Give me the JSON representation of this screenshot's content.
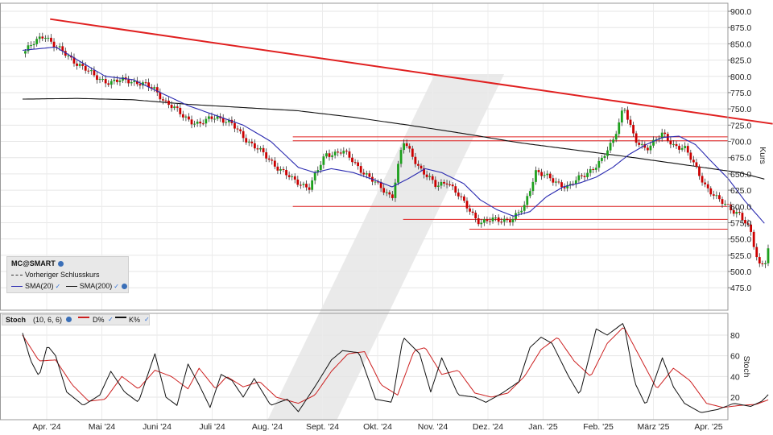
{
  "chart_data": [
    {
      "type": "candlestick",
      "symbol": "MC@SMART",
      "ylabel": "Kurs",
      "ylim": [
        460,
        915
      ],
      "y_ticks": [
        "900.0",
        "875.0",
        "850.0",
        "825.0",
        "800.0",
        "775.0",
        "750.0",
        "725.0",
        "700.0",
        "675.0",
        "650.0",
        "625.0",
        "600.0",
        "575.0",
        "550.0",
        "525.0",
        "500.0",
        "475.0"
      ],
      "x_ticks": [
        "Apr. '24",
        "Mai '24",
        "Juni '24",
        "Juli '24",
        "Aug. '24",
        "Sept. '24",
        "Okt. '24",
        "Nov. '24",
        "Dez. '24",
        "Jan. '25",
        "Feb. '25",
        "März '25",
        "Apr. '25"
      ],
      "legend": {
        "title": "MC@SMART",
        "prev_close_label": "Vorheriger Schlusskurs",
        "sma20_label": "SMA(20)",
        "sma200_label": "SMA(200)"
      },
      "colors": {
        "up": "#1ea01e",
        "down": "#cc0000",
        "sma20": "#2a2ab0",
        "sma200": "#111111",
        "trend": "#e02020"
      },
      "trendline": {
        "from": [
          0.5,
          888
        ],
        "to": [
          13.6,
          727
        ]
      },
      "horizontal_levels": [
        {
          "value": 707,
          "from": 4.9
        },
        {
          "value": 701,
          "from": 4.9
        },
        {
          "value": 600,
          "from": 4.9
        },
        {
          "value": 580,
          "from": 6.9
        },
        {
          "value": 565,
          "from": 8.1
        }
      ],
      "series": [
        {
          "name": "Kurs",
          "key_points": [
            [
              0.0,
              835
            ],
            [
              0.4,
              865
            ],
            [
              0.6,
              845
            ],
            [
              1.0,
              820
            ],
            [
              1.3,
              800
            ],
            [
              1.6,
              790
            ],
            [
              1.9,
              795
            ],
            [
              2.1,
              790
            ],
            [
              2.4,
              780
            ],
            [
              2.6,
              760
            ],
            [
              2.9,
              740
            ],
            [
              3.2,
              725
            ],
            [
              3.5,
              740
            ],
            [
              3.8,
              725
            ],
            [
              4.1,
              700
            ],
            [
              4.5,
              670
            ],
            [
              4.9,
              640
            ],
            [
              5.2,
              630
            ],
            [
              5.5,
              680
            ],
            [
              5.8,
              685
            ],
            [
              6.1,
              660
            ],
            [
              6.4,
              635
            ],
            [
              6.7,
              615
            ],
            [
              6.9,
              700
            ],
            [
              7.2,
              660
            ],
            [
              7.5,
              630
            ],
            [
              7.7,
              640
            ],
            [
              8.0,
              605
            ],
            [
              8.3,
              575
            ],
            [
              8.6,
              580
            ],
            [
              8.9,
              580
            ],
            [
              9.1,
              600
            ],
            [
              9.3,
              655
            ],
            [
              9.6,
              640
            ],
            [
              9.9,
              630
            ],
            [
              10.2,
              650
            ],
            [
              10.5,
              670
            ],
            [
              10.7,
              700
            ],
            [
              10.9,
              755
            ],
            [
              11.1,
              700
            ],
            [
              11.3,
              690
            ],
            [
              11.6,
              710
            ],
            [
              11.8,
              695
            ],
            [
              12.0,
              690
            ],
            [
              12.2,
              660
            ],
            [
              12.4,
              630
            ],
            [
              12.6,
              610
            ],
            [
              12.8,
              600
            ],
            [
              13.0,
              588
            ],
            [
              13.2,
              560
            ],
            [
              13.35,
              510
            ],
            [
              13.5,
              520
            ],
            [
              13.55,
              560
            ]
          ]
        },
        {
          "name": "SMA(20)",
          "key_points": [
            [
              0.0,
              840
            ],
            [
              0.6,
              845
            ],
            [
              1.0,
              825
            ],
            [
              1.5,
              800
            ],
            [
              2.0,
              795
            ],
            [
              2.5,
              775
            ],
            [
              3.0,
              755
            ],
            [
              3.5,
              740
            ],
            [
              4.0,
              725
            ],
            [
              4.5,
              700
            ],
            [
              5.0,
              660
            ],
            [
              5.3,
              652
            ],
            [
              5.6,
              658
            ],
            [
              6.0,
              652
            ],
            [
              6.4,
              640
            ],
            [
              6.7,
              630
            ],
            [
              7.0,
              643
            ],
            [
              7.3,
              658
            ],
            [
              7.6,
              652
            ],
            [
              8.0,
              635
            ],
            [
              8.3,
              610
            ],
            [
              8.6,
              595
            ],
            [
              8.9,
              585
            ],
            [
              9.2,
              592
            ],
            [
              9.5,
              615
            ],
            [
              9.8,
              630
            ],
            [
              10.1,
              636
            ],
            [
              10.4,
              645
            ],
            [
              10.7,
              660
            ],
            [
              11.0,
              680
            ],
            [
              11.3,
              695
            ],
            [
              11.6,
              706
            ],
            [
              11.9,
              708
            ],
            [
              12.2,
              695
            ],
            [
              12.5,
              668
            ],
            [
              12.8,
              642
            ],
            [
              13.1,
              608
            ],
            [
              13.45,
              574
            ]
          ]
        },
        {
          "name": "SMA(200)",
          "key_points": [
            [
              0.0,
              765
            ],
            [
              1.0,
              766
            ],
            [
              2.0,
              764
            ],
            [
              3.0,
              757
            ],
            [
              4.0,
              752
            ],
            [
              5.0,
              747
            ],
            [
              6.0,
              737
            ],
            [
              7.0,
              725
            ],
            [
              8.0,
              712
            ],
            [
              9.0,
              698
            ],
            [
              10.0,
              687
            ],
            [
              11.0,
              676
            ],
            [
              12.0,
              664
            ],
            [
              13.0,
              652
            ],
            [
              13.45,
              642
            ]
          ]
        }
      ]
    },
    {
      "type": "line",
      "indicator": "Stoch",
      "params": "(10, 6, 6)",
      "ylabel": "Stoch",
      "ylim": [
        0,
        100
      ],
      "y_ticks": [
        "80",
        "60",
        "40",
        "20"
      ],
      "legend": {
        "title": "Stoch",
        "params": "(10, 6, 6)",
        "d_label": "D%",
        "k_label": "K%"
      },
      "colors": {
        "d": "#cc2020",
        "k": "#111111"
      },
      "series": [
        {
          "name": "K%",
          "key_points": [
            [
              0.0,
              82
            ],
            [
              0.15,
              55
            ],
            [
              0.3,
              40
            ],
            [
              0.45,
              70
            ],
            [
              0.6,
              60
            ],
            [
              0.8,
              25
            ],
            [
              1.1,
              12
            ],
            [
              1.4,
              22
            ],
            [
              1.6,
              45
            ],
            [
              1.85,
              25
            ],
            [
              2.1,
              15
            ],
            [
              2.4,
              62
            ],
            [
              2.6,
              20
            ],
            [
              2.8,
              12
            ],
            [
              3.0,
              52
            ],
            [
              3.2,
              32
            ],
            [
              3.4,
              10
            ],
            [
              3.6,
              42
            ],
            [
              3.8,
              36
            ],
            [
              4.0,
              20
            ],
            [
              4.2,
              38
            ],
            [
              4.5,
              12
            ],
            [
              4.8,
              18
            ],
            [
              5.0,
              6
            ],
            [
              5.3,
              30
            ],
            [
              5.6,
              56
            ],
            [
              5.8,
              65
            ],
            [
              6.1,
              63
            ],
            [
              6.4,
              18
            ],
            [
              6.7,
              15
            ],
            [
              6.9,
              78
            ],
            [
              7.2,
              62
            ],
            [
              7.4,
              25
            ],
            [
              7.6,
              58
            ],
            [
              7.9,
              22
            ],
            [
              8.2,
              20
            ],
            [
              8.4,
              15
            ],
            [
              8.7,
              24
            ],
            [
              9.0,
              35
            ],
            [
              9.2,
              68
            ],
            [
              9.4,
              78
            ],
            [
              9.6,
              72
            ],
            [
              9.9,
              40
            ],
            [
              10.1,
              22
            ],
            [
              10.4,
              86
            ],
            [
              10.6,
              80
            ],
            [
              10.9,
              92
            ],
            [
              11.1,
              34
            ],
            [
              11.3,
              12
            ],
            [
              11.6,
              58
            ],
            [
              11.8,
              30
            ],
            [
              12.0,
              14
            ],
            [
              12.3,
              5
            ],
            [
              12.6,
              8
            ],
            [
              12.9,
              14
            ],
            [
              13.2,
              11
            ],
            [
              13.4,
              16
            ],
            [
              13.55,
              24
            ]
          ]
        },
        {
          "name": "D%",
          "key_points": [
            [
              0.0,
              80
            ],
            [
              0.3,
              55
            ],
            [
              0.6,
              56
            ],
            [
              0.9,
              32
            ],
            [
              1.2,
              16
            ],
            [
              1.5,
              18
            ],
            [
              1.8,
              40
            ],
            [
              2.1,
              28
            ],
            [
              2.4,
              46
            ],
            [
              2.7,
              40
            ],
            [
              3.0,
              28
            ],
            [
              3.2,
              48
            ],
            [
              3.5,
              28
            ],
            [
              3.7,
              40
            ],
            [
              4.0,
              30
            ],
            [
              4.3,
              35
            ],
            [
              4.6,
              20
            ],
            [
              5.0,
              14
            ],
            [
              5.3,
              22
            ],
            [
              5.6,
              45
            ],
            [
              5.9,
              62
            ],
            [
              6.2,
              64
            ],
            [
              6.5,
              32
            ],
            [
              6.8,
              22
            ],
            [
              7.1,
              65
            ],
            [
              7.3,
              68
            ],
            [
              7.6,
              42
            ],
            [
              7.9,
              46
            ],
            [
              8.2,
              24
            ],
            [
              8.5,
              20
            ],
            [
              8.8,
              24
            ],
            [
              9.1,
              40
            ],
            [
              9.4,
              66
            ],
            [
              9.7,
              78
            ],
            [
              10.0,
              55
            ],
            [
              10.3,
              40
            ],
            [
              10.6,
              72
            ],
            [
              10.9,
              88
            ],
            [
              11.2,
              58
            ],
            [
              11.5,
              28
            ],
            [
              11.8,
              48
            ],
            [
              12.1,
              36
            ],
            [
              12.4,
              14
            ],
            [
              12.7,
              10
            ],
            [
              13.0,
              12
            ],
            [
              13.3,
              13
            ],
            [
              13.55,
              18
            ]
          ]
        }
      ]
    }
  ]
}
